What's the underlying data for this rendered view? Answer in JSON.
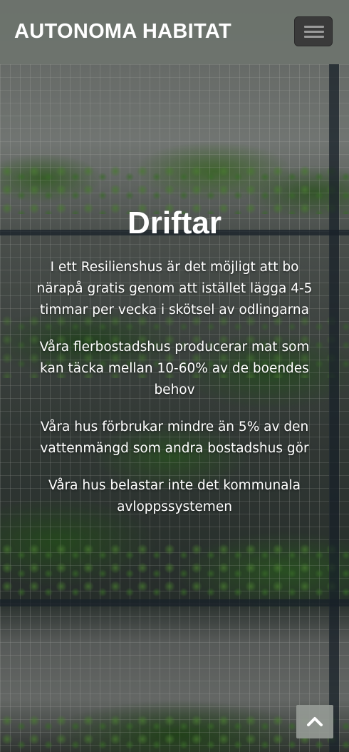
{
  "navbar": {
    "brand": "AUTONOMA HABITAT",
    "menu_icon": "hamburger-menu-icon"
  },
  "hero": {
    "title": "Driftar",
    "paragraphs": [
      "I ett Resilienshus är det möjligt att bo närapå gratis genom att istället lägga 4-5 timmar per vecka i skötsel av odlingarna",
      "Våra flerbostadshus producerar mat som kan täcka mellan 10-60% av de boendes behov",
      "Våra hus förbrukar mindre än 5% av den vattenmängd som andra bostadshus gör",
      "Våra hus belastar inte det kommunala avloppssystemen"
    ]
  },
  "scroll_top": {
    "icon": "chevron-up-icon"
  }
}
